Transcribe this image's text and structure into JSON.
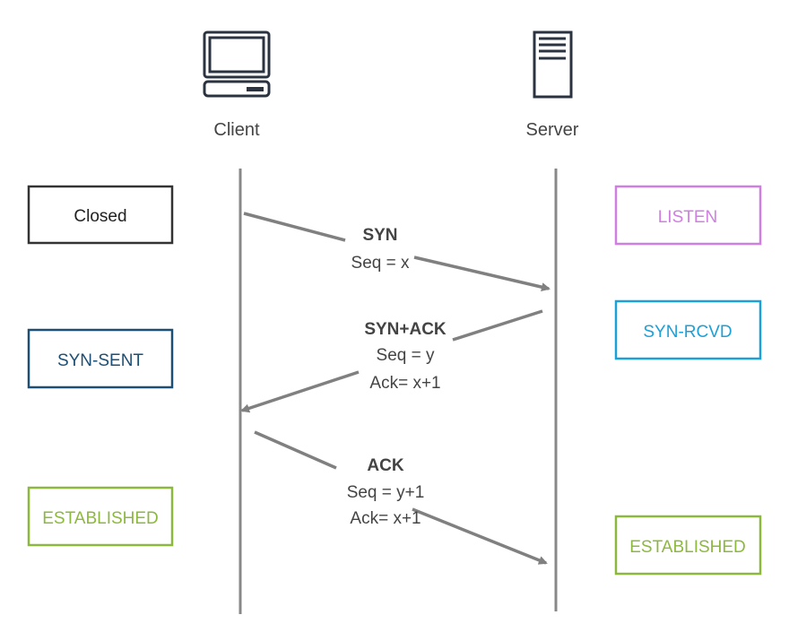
{
  "actors": {
    "client": {
      "label": "Client",
      "icon": "computer-icon"
    },
    "server": {
      "label": "Server",
      "icon": "server-icon"
    }
  },
  "client_states": [
    {
      "label": "Closed",
      "color": "#333333"
    },
    {
      "label": "SYN-SENT",
      "color": "#1d4e73"
    },
    {
      "label": "ESTABLISHED",
      "color": "#8db83e"
    }
  ],
  "server_states": [
    {
      "label": "LISTEN",
      "color": "#cf7fe0"
    },
    {
      "label": "SYN-RCVD",
      "color": "#1ba0d8"
    },
    {
      "label": "ESTABLISHED",
      "color": "#8db83e"
    }
  ],
  "messages": [
    {
      "title": "SYN",
      "title_color": "#1a72c0",
      "lines": [
        "Seq = x"
      ],
      "direction": "client-to-server"
    },
    {
      "title": "SYN+ACK",
      "title_color": "#e8192c",
      "lines": [
        "Seq = y",
        "Ack= x+1"
      ],
      "direction": "server-to-client"
    },
    {
      "title": "ACK",
      "title_color": "#3d6fc4",
      "lines": [
        "Seq = y+1",
        "Ack= x+1"
      ],
      "direction": "client-to-server"
    }
  ],
  "colors": {
    "lifeline": "#888888",
    "arrow": "#808080",
    "icon": "#2b3340"
  }
}
